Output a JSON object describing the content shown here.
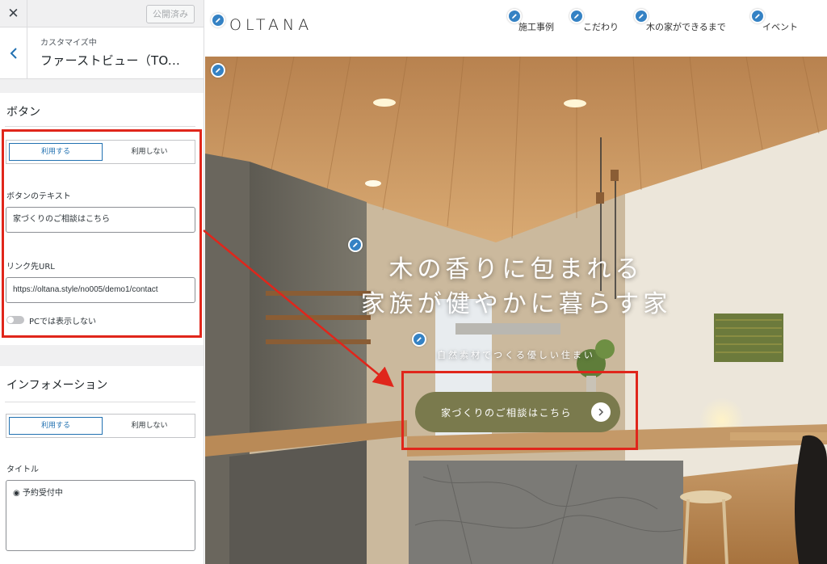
{
  "customizer": {
    "close_icon": "close-icon",
    "publish_label": "公開済み",
    "section_subtitle": "カスタマイズ中",
    "section_title": "ファーストビュー（TO...",
    "back_icon": "chevron-left-icon"
  },
  "button_panel": {
    "title": "ボタン",
    "toggle": {
      "on_label": "利用する",
      "off_label": "利用しない",
      "selected": "利用する"
    },
    "text_label": "ボタンのテキスト",
    "text_value": "家づくりのご相談はこちら",
    "url_label": "リンク先URL",
    "url_value": "https://oltana.style/no005/demo1/contact",
    "pc_hide_label": "PCでは表示しない",
    "pc_hide_on": false
  },
  "info_panel": {
    "title": "インフォメーション",
    "toggle": {
      "on_label": "利用する",
      "off_label": "利用しない",
      "selected": "利用する"
    },
    "title_label": "タイトル",
    "title_value": "◉ 予約受付中"
  },
  "site": {
    "logo": "OLTANA",
    "nav": [
      "施工事例",
      "こだわり",
      "木の家ができるまで",
      "イベント"
    ],
    "hero_title_line1": "木の香りに包まれる",
    "hero_title_line2": "家族が健やかに暮らす家",
    "hero_subtitle": "自然素材でつくる優しい住まい",
    "cta_label": "家づくりのご相談はこちら"
  },
  "colors": {
    "annotation_red": "#e0261b",
    "edit_pen_blue": "#3582c4",
    "wp_accent": "#2271b1",
    "cta_olive": "#7a7a4d"
  }
}
